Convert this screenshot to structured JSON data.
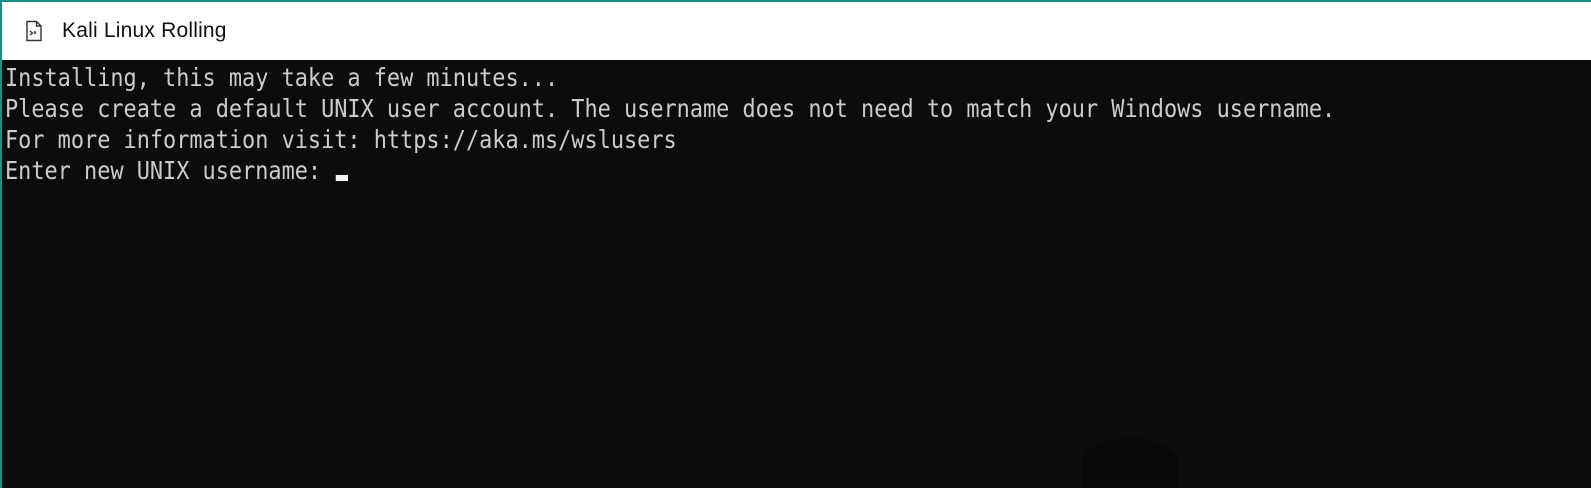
{
  "window": {
    "title": "Kali Linux Rolling",
    "icon": "terminal-document-icon",
    "accent_color": "#1a8f8f",
    "background_color": "#0c0c0c",
    "text_color": "#cccccc"
  },
  "terminal": {
    "lines": [
      "Installing, this may take a few minutes...",
      "Please create a default UNIX user account. The username does not need to match your Windows username.",
      "For more information visit: https://aka.ms/wslusers",
      "Enter new UNIX username: "
    ]
  }
}
